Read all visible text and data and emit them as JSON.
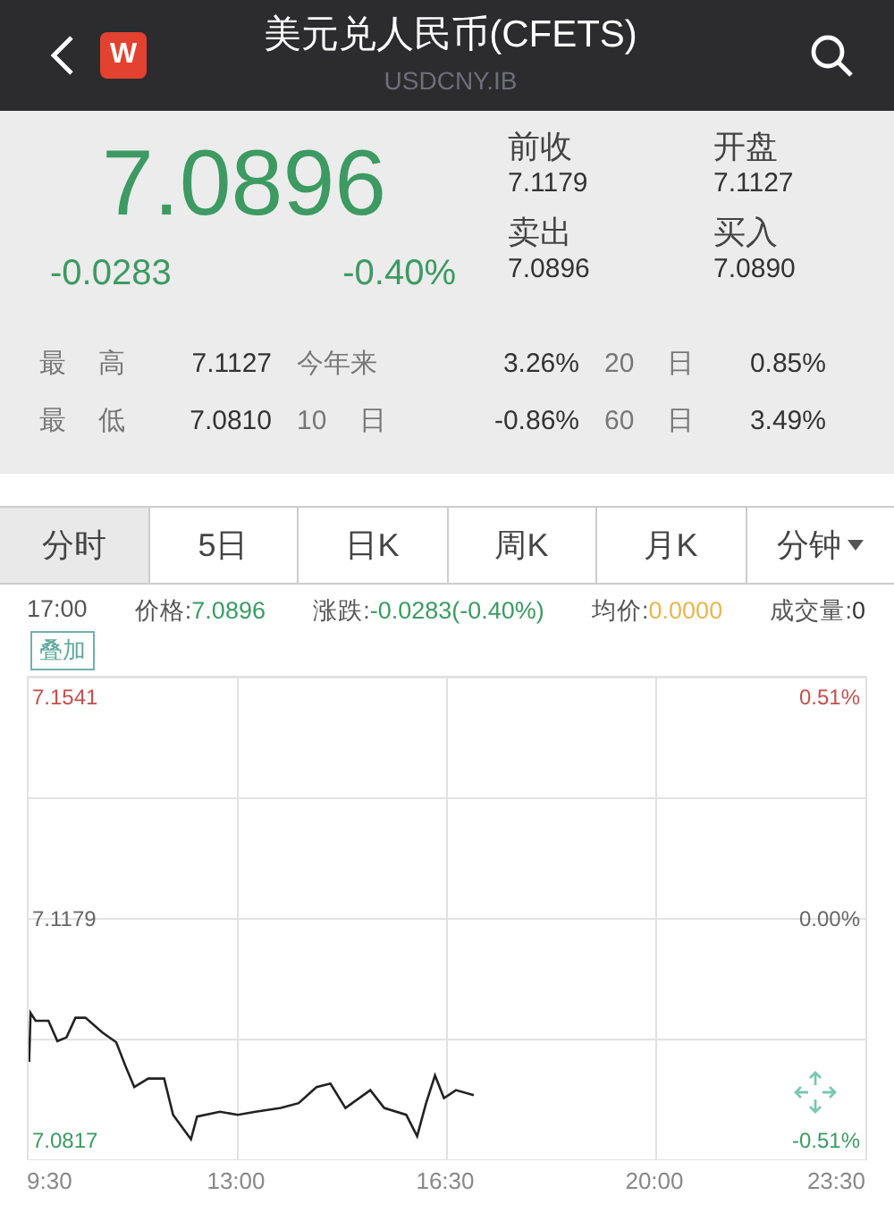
{
  "header": {
    "logo": "W",
    "title": "美元兑人民币(CFETS)",
    "subtitle": "USDCNY.IB"
  },
  "quote": {
    "price": "7.0896",
    "change": "-0.0283",
    "change_pct": "-0.40%",
    "fields": [
      {
        "label": "前收",
        "value": "7.1179"
      },
      {
        "label": "开盘",
        "value": "7.1127"
      },
      {
        "label": "卖出",
        "value": "7.0896"
      },
      {
        "label": "买入",
        "value": "7.0890"
      }
    ]
  },
  "stats": [
    [
      {
        "label": "最 高",
        "value": "7.1127"
      },
      {
        "label": "今年来",
        "value": "3.26%"
      },
      {
        "label": "20 日",
        "value": "0.85%"
      }
    ],
    [
      {
        "label": "最 低",
        "value": "7.0810"
      },
      {
        "label": "10 日",
        "value": "-0.86%"
      },
      {
        "label": "60 日",
        "value": "3.49%"
      }
    ]
  ],
  "tabs": [
    {
      "label": "分时",
      "selected": true,
      "kind": "plain"
    },
    {
      "label": "5日",
      "selected": false,
      "kind": "plain"
    },
    {
      "label": "日K",
      "selected": false,
      "kind": "plain"
    },
    {
      "label": "周K",
      "selected": false,
      "kind": "plain"
    },
    {
      "label": "月K",
      "selected": false,
      "kind": "plain"
    },
    {
      "label": "分钟",
      "selected": false,
      "kind": "dropdown"
    }
  ],
  "info": {
    "time": "17:00",
    "items": [
      {
        "label": "价格:",
        "value": "7.0896",
        "color": "#3c9a62"
      },
      {
        "label": "涨跌:",
        "value": "-0.0283(-0.40%)",
        "color": "#3c9a62"
      },
      {
        "label": "均价:",
        "value": "0.0000",
        "color": "#e8b64c"
      },
      {
        "label": "成交量:",
        "value": "0",
        "color": "#333333"
      }
    ]
  },
  "overlay_button": "叠加",
  "chart": {
    "right_labels": [
      "0.51%",
      "0.00%",
      "-0.51%"
    ],
    "chart_data": {
      "type": "line",
      "xlim": [
        9.5,
        23.5
      ],
      "ylim": [
        7.0786,
        7.1572
      ],
      "grid": true,
      "xticks": [
        {
          "value": 9.5,
          "label": "9:30"
        },
        {
          "value": 13,
          "label": "13:00"
        },
        {
          "value": 16.5,
          "label": "16:30"
        },
        {
          "value": 20,
          "label": "20:00"
        },
        {
          "value": 23.5,
          "label": "23:30"
        }
      ],
      "yticks": [
        {
          "value": 7.0817,
          "label": "7.0817"
        },
        {
          "value": 7.1179,
          "label": "7.1179"
        },
        {
          "value": 7.1541,
          "label": "7.1541"
        }
      ],
      "x": [
        9.51,
        9.533,
        9.617,
        9.833,
        9.983,
        10.133,
        10.283,
        10.45,
        10.733,
        10.967,
        11.117,
        11.267,
        11.5,
        11.767,
        11.917,
        12.217,
        12.317,
        12.7,
        13,
        13.3,
        13.717,
        14.017,
        14.317,
        14.55,
        14.8,
        15.217,
        15.45,
        15.817,
        16,
        16.15,
        16.3,
        16.45,
        16.65,
        16.95
      ],
      "series": [
        {
          "color": "#222222",
          "values": [
            7.0946,
            7.1026,
            7.1013,
            7.1013,
            7.098,
            7.0986,
            7.1018,
            7.1018,
            7.0994,
            7.0978,
            7.094,
            7.0905,
            7.0919,
            7.0919,
            7.086,
            7.082,
            7.0857,
            7.0865,
            7.086,
            7.0865,
            7.0871,
            7.0879,
            7.0905,
            7.0911,
            7.0871,
            7.09,
            7.0871,
            7.086,
            7.0825,
            7.0879,
            7.0924,
            7.0887,
            7.09,
            7.0892
          ]
        }
      ]
    }
  }
}
